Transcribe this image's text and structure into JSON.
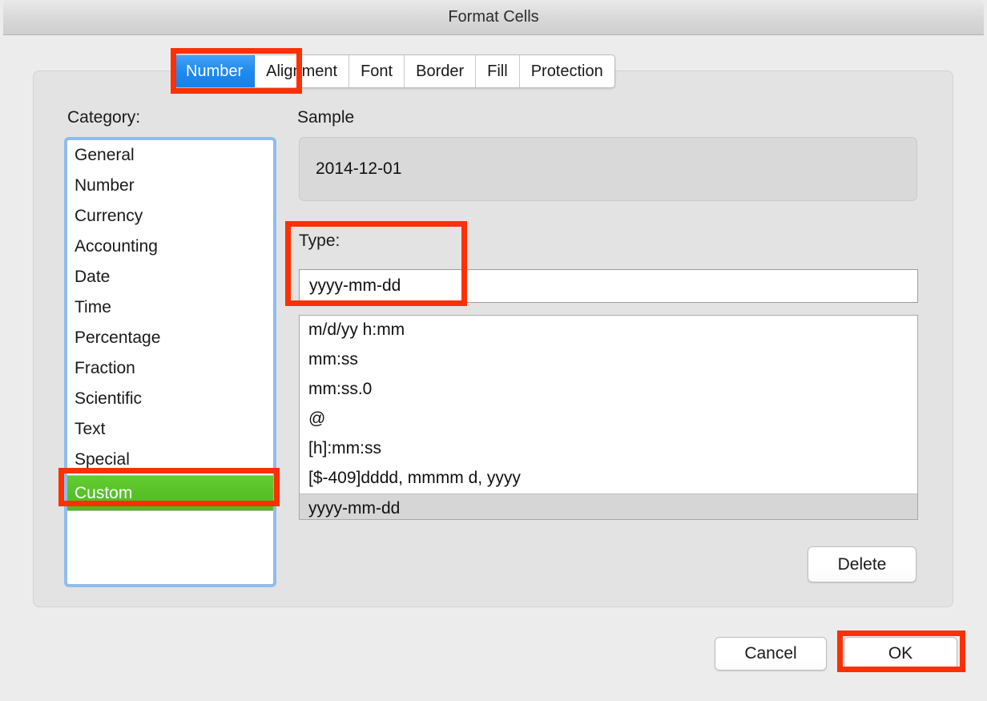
{
  "window": {
    "title": "Format Cells"
  },
  "tabs": [
    {
      "label": "Number",
      "active": true
    },
    {
      "label": "Alignment",
      "active": false
    },
    {
      "label": "Font",
      "active": false
    },
    {
      "label": "Border",
      "active": false
    },
    {
      "label": "Fill",
      "active": false
    },
    {
      "label": "Protection",
      "active": false
    }
  ],
  "category": {
    "label": "Category:",
    "items": [
      {
        "label": "General",
        "selected": false
      },
      {
        "label": "Number",
        "selected": false
      },
      {
        "label": "Currency",
        "selected": false
      },
      {
        "label": "Accounting",
        "selected": false
      },
      {
        "label": "Date",
        "selected": false
      },
      {
        "label": "Time",
        "selected": false
      },
      {
        "label": "Percentage",
        "selected": false
      },
      {
        "label": "Fraction",
        "selected": false
      },
      {
        "label": "Scientific",
        "selected": false
      },
      {
        "label": "Text",
        "selected": false
      },
      {
        "label": "Special",
        "selected": false
      },
      {
        "label": "Custom",
        "selected": true
      }
    ],
    "selected_value": "Custom"
  },
  "sample": {
    "label": "Sample",
    "value": "2014-12-01"
  },
  "type": {
    "label": "Type:",
    "value": "yyyy-mm-dd",
    "placeholder": ""
  },
  "format_list": {
    "items": [
      {
        "label": "m/d/yy h:mm",
        "selected": false
      },
      {
        "label": "mm:ss",
        "selected": false
      },
      {
        "label": "mm:ss.0",
        "selected": false
      },
      {
        "label": "@",
        "selected": false
      },
      {
        "label": "[h]:mm:ss",
        "selected": false
      },
      {
        "label": "[$-409]dddd, mmmm d, yyyy",
        "selected": false
      },
      {
        "label": "yyyy-mm-dd",
        "selected": true
      }
    ],
    "selected_value": "yyyy-mm-dd"
  },
  "buttons": {
    "delete": "Delete",
    "cancel": "Cancel",
    "ok": "OK"
  },
  "annotations": {
    "color": "#fc3004",
    "targets": [
      "Number tab",
      "Type: field",
      "Custom category",
      "OK button"
    ]
  },
  "colors": {
    "accent_blue": "#1e8bf0",
    "selection_green": "#56c127",
    "annotation_red": "#fc3004",
    "window_background": "#ececec",
    "panel_background": "#e3e3e3"
  }
}
